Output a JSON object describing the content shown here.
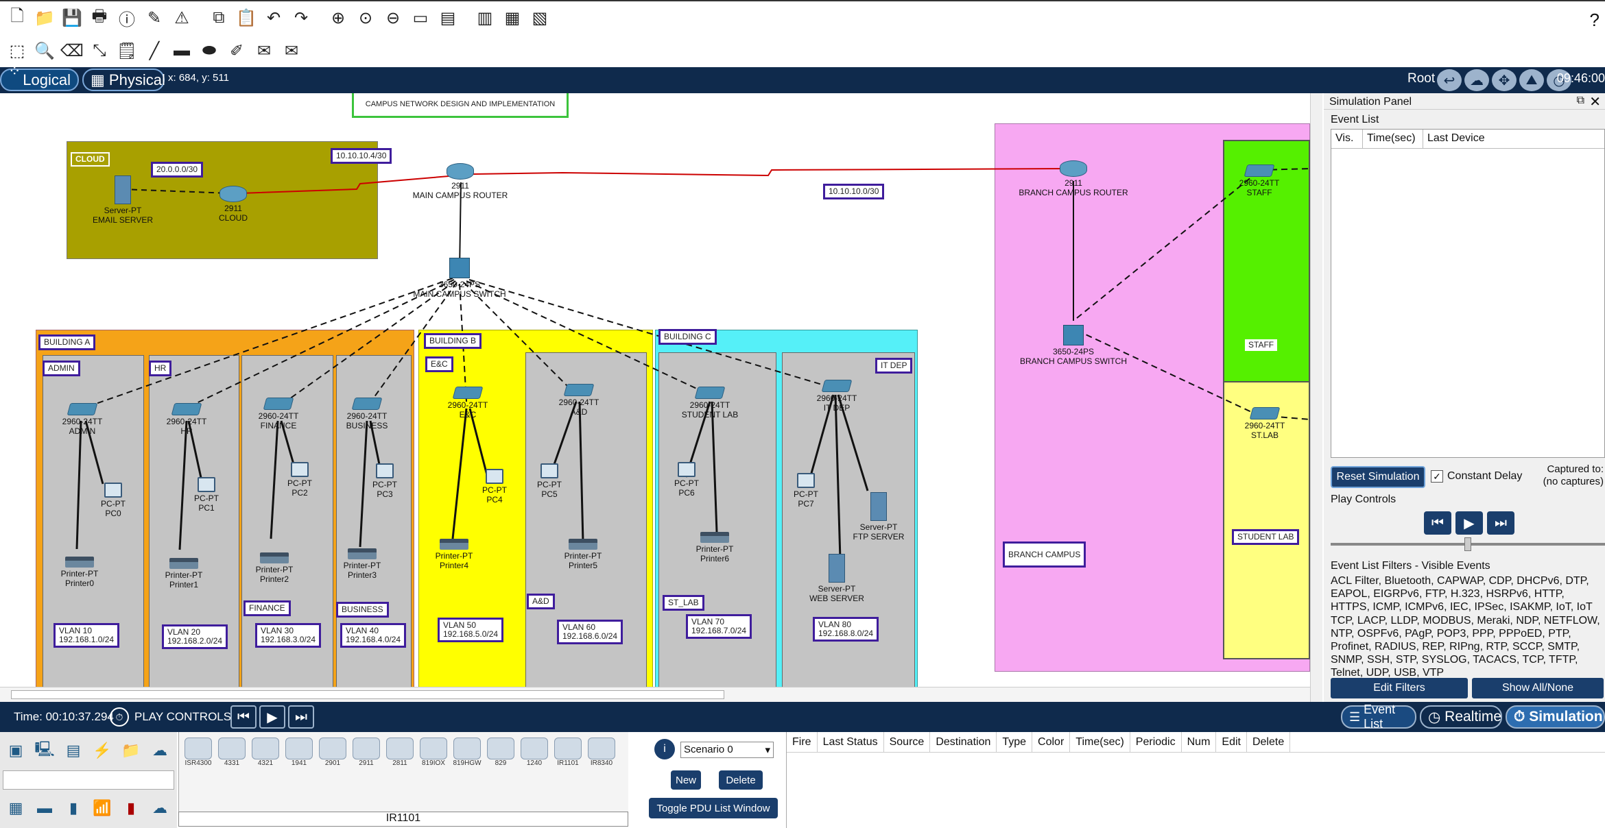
{
  "toolbar1": {
    "icons": [
      "new-file-icon",
      "open-folder-icon",
      "save-icon",
      "print-icon",
      "info-icon",
      "activity-wizard-icon",
      "network-info-icon",
      "copy-icon",
      "paste-icon",
      "undo-icon",
      "redo-icon",
      "zoom-in-icon",
      "zoom-reset-icon",
      "zoom-out-icon",
      "drawing-palette-icon",
      "custom-device-icon",
      "viewport-icon",
      "image-icon"
    ],
    "help": "?"
  },
  "toolbar2": {
    "icons": [
      "select-icon",
      "inspect-icon",
      "delete-icon",
      "resize-icon",
      "note-icon",
      "line-icon",
      "rectangle-icon",
      "ellipse-icon",
      "freeform-icon",
      "simple-pdu-icon",
      "complex-pdu-icon"
    ]
  },
  "modebar": {
    "logical": "Logical",
    "physical": "Physical",
    "coords": "x: 684, y: 511",
    "root": "Root",
    "clock": "09:46:00"
  },
  "diagram": {
    "title": "CAMPUS NETWORK DESIGN AND IMPLEMENTATION",
    "cloud_area": "CLOUD",
    "cloud_net": "20.0.0.0/30",
    "main_wan_net": "10.10.10.4/30",
    "branch_wan_net": "10.10.10.0/30",
    "email_server": {
      "model": "Server-PT",
      "name": "EMAIL SERVER"
    },
    "cloud_router": {
      "model": "2911",
      "name": "CLOUD"
    },
    "main_router": {
      "model": "2911",
      "name": "MAIN CAMPUS ROUTER"
    },
    "main_switch": {
      "model": "3650-24PS",
      "name": "MAIN CAMPUS SWITCH"
    },
    "building_a": "BUILDING A",
    "building_b": "BUILDING B",
    "building_c": "BUILDING C",
    "depts": {
      "admin": "ADMIN",
      "hr": "HR",
      "finance": "FINANCE",
      "business": "BUSINESS",
      "ec": "E&C",
      "ad": "A&D",
      "st_lab": "ST_LAB",
      "it_dep": "IT DEP"
    },
    "switches": [
      {
        "model": "2960-24TT",
        "name": "ADMIN"
      },
      {
        "model": "2960-24TT",
        "name": "HR"
      },
      {
        "model": "2960-24TT",
        "name": "FINANCE"
      },
      {
        "model": "2960-24TT",
        "name": "BUSINESS"
      },
      {
        "model": "2960-24TT",
        "name": "E&C"
      },
      {
        "model": "2960-24TT",
        "name": "A&D"
      },
      {
        "model": "2960-24TT",
        "name": "STUDENT LAB"
      },
      {
        "model": "2960-24TT",
        "name": "IT DEP"
      }
    ],
    "pcs": [
      {
        "model": "PC-PT",
        "name": "PC0"
      },
      {
        "model": "PC-PT",
        "name": "PC1"
      },
      {
        "model": "PC-PT",
        "name": "PC2"
      },
      {
        "model": "PC-PT",
        "name": "PC3"
      },
      {
        "model": "PC-PT",
        "name": "PC4"
      },
      {
        "model": "PC-PT",
        "name": "PC5"
      },
      {
        "model": "PC-PT",
        "name": "PC6"
      },
      {
        "model": "PC-PT",
        "name": "PC7"
      }
    ],
    "printers": [
      {
        "model": "Printer-PT",
        "name": "Printer0"
      },
      {
        "model": "Printer-PT",
        "name": "Printer1"
      },
      {
        "model": "Printer-PT",
        "name": "Printer2"
      },
      {
        "model": "Printer-PT",
        "name": "Printer3"
      },
      {
        "model": "Printer-PT",
        "name": "Printer4"
      },
      {
        "model": "Printer-PT",
        "name": "Printer5"
      },
      {
        "model": "Printer-PT",
        "name": "Printer6"
      }
    ],
    "ftp_server": {
      "model": "Server-PT",
      "name": "FTP SERVER"
    },
    "web_server": {
      "model": "Server-PT",
      "name": "WEB SERVER"
    },
    "vlans": [
      {
        "vlan": "VLAN 10",
        "net": "192.168.1.0/24"
      },
      {
        "vlan": "VLAN 20",
        "net": "192.168.2.0/24"
      },
      {
        "vlan": "VLAN 30",
        "net": "192.168.3.0/24"
      },
      {
        "vlan": "VLAN 40",
        "net": "192.168.4.0/24"
      },
      {
        "vlan": "VLAN 50",
        "net": "192.168.5.0/24"
      },
      {
        "vlan": "VLAN 60",
        "net": "192.168.6.0/24"
      },
      {
        "vlan": "VLAN 70",
        "net": "192.168.7.0/24"
      },
      {
        "vlan": "VLAN 80",
        "net": "192.168.8.0/24"
      }
    ],
    "branch": {
      "area": "BRANCH CAMPUS",
      "router_model": "2911",
      "router_name": "BRANCH CAMPUS ROUTER",
      "switch_model": "3650-24PS",
      "switch_name": "BRANCH CAMPUS SWITCH",
      "staff_model": "2960-24TT",
      "staff_name": "STAFF",
      "stlab_model": "2960-24TT",
      "stlab_name": "ST.LAB",
      "staff_area": "STAFF",
      "student_lab_area": "STUDENT LAB"
    }
  },
  "sim_panel": {
    "title": "Simulation Panel",
    "event_list_label": "Event List",
    "columns": [
      "Vis.",
      "Time(sec)",
      "Last Device"
    ],
    "reset": "Reset Simulation",
    "constant_delay": "Constant Delay",
    "captured": "Captured to:",
    "no_captures": "(no captures)",
    "play_controls": "Play Controls",
    "filters_label": "Event List Filters - Visible Events",
    "filters_text": "ACL Filter, Bluetooth, CAPWAP, CDP, DHCPv6, DTP, EAPOL, EIGRPv6, FTP, H.323, HSRPv6, HTTP, HTTPS, ICMP, ICMPv6, IEC, IPSec, ISAKMP, IoT, IoT TCP, LACP, LLDP, MODBUS, Meraki, NDP, NETFLOW, NTP, OSPFv6, PAgP, POP3, PPP, PPPoED, PTP, Profinet, RADIUS, REP, RIPng, RTP, SCCP, SMTP, SNMP, SSH, STP, SYSLOG, TACACS, TCP, TFTP, Telnet, UDP, USB, VTP",
    "edit_filters": "Edit Filters",
    "show_all": "Show All/None"
  },
  "bottombar": {
    "time": "Time: 00:10:37.294",
    "play_controls": "PLAY CONTROLS",
    "event_list": "Event List",
    "realtime": "Realtime",
    "simulation": "Simulation"
  },
  "device_types": [
    "ISR4300",
    "4331",
    "4321",
    "1941",
    "2901",
    "2911",
    "2811",
    "819IOX",
    "819HGW",
    "829",
    "1240",
    "IR1101",
    "IR8340"
  ],
  "device_name": "IR1101",
  "scenario": {
    "selected": "Scenario 0",
    "new": "New",
    "delete": "Delete",
    "toggle": "Toggle PDU List Window"
  },
  "pdu_columns": [
    "Fire",
    "Last Status",
    "Source",
    "Destination",
    "Type",
    "Color",
    "Time(sec)",
    "Periodic",
    "Num",
    "Edit",
    "Delete"
  ],
  "colors": {
    "navy": "#0f2a4c",
    "cloud_area": "#a8a000",
    "building_a": "#f5a318",
    "building_b": "#ffff00",
    "building_c": "#55f0f8",
    "branch": "#f7a8f2",
    "staff": "#55f000",
    "stlab": "#ffff80",
    "dept_gray": "#c4c4c4",
    "wan_link": "#cc0000",
    "label_border": "#3f1d9c"
  }
}
